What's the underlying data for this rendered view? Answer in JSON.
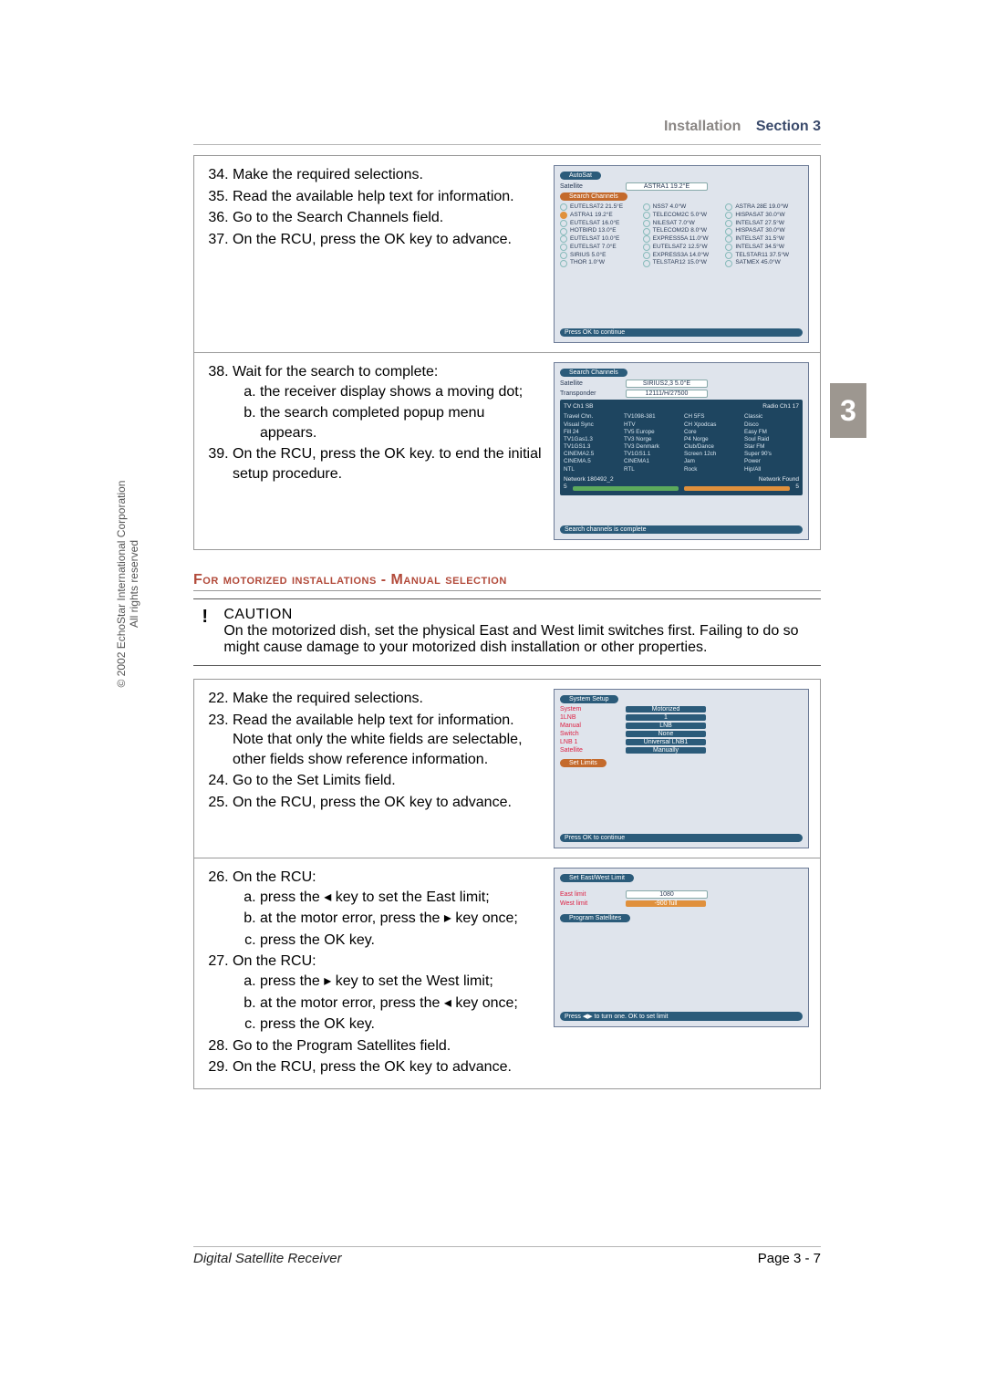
{
  "header": {
    "left": "Installation",
    "right": "Section 3"
  },
  "side_copyright": {
    "line1": "© 2002 EchoStar International Corporation",
    "line2": "All rights reserved"
  },
  "chapter_tab": "3",
  "box1": {
    "s34": "Make the required selections.",
    "s35": "Read the available help text for information.",
    "s36": "Go to the Search Channels field.",
    "s37": "On the RCU, press the OK key to advance."
  },
  "fig1": {
    "autosat": "AutoSat",
    "satellite_label": "Satellite",
    "satellite_value": "ASTRA1 19.2°E",
    "search_btn": "Search Channels",
    "footer": "Press OK to continue",
    "sats_col1": [
      "EUTELSAT2 21.5°E",
      "ASTRA1 19.2°E",
      "EUTELSAT 16.0°E",
      "HOTBIRD 13.0°E",
      "EUTELSAT 10.0°E",
      "EUTELSAT 7.0°E",
      "SIRIUS 5.0°E",
      "THOR 1.0°W"
    ],
    "sats_col2": [
      "NSS7 4.0°W",
      "TELECOM2C 5.0°W",
      "NILESAT 7.0°W",
      "TELECOM2D 8.0°W",
      "EXPRESS5A 11.0°W",
      "EUTELSAT2 12.5°W",
      "EXPRESS3A 14.0°W",
      "TELSTAR12 15.0°W"
    ],
    "sats_col3": [
      "ASTRA 28E 19.0°W",
      "HISPASAT 30.0°W",
      "INTELSAT 27.5°W",
      "HISPASAT 30.0°W",
      "INTELSAT 31.5°W",
      "INTELSAT 34.5°W",
      "TELSTAR11 37.5°W",
      "SATMEX 45.0°W"
    ]
  },
  "box2": {
    "s38": "Wait for the search to complete:",
    "s38a": "the receiver display shows a moving dot;",
    "s38b": "the search completed popup menu appears.",
    "s39": "On the RCU, press the OK key. to end the initial setup procedure."
  },
  "fig2": {
    "btn": "Search Channels",
    "satellite_label": "Satellite",
    "satellite_value": "SIRIUS2,3 5.0°E",
    "transponder_label": "Transponder",
    "transponder_value": "12111/H/27500",
    "tv_header": "TV Ch1 SB",
    "radio_header": "Radio Ch1 17",
    "tv_col1": [
      "Travel Chn.",
      "Visual Sync",
      "Fill 24",
      "TV1Gas1.3",
      "TV1GS1.3",
      "CINEMA2.5",
      "CINEMA.5",
      "NTL"
    ],
    "tv_col2": [
      "TV1098-381",
      "HTV",
      "TV5 Europe",
      "TV3 Norge",
      "TV3 Denmark",
      "TV1GS1.1",
      "CINEMA1",
      "RTL"
    ],
    "radio_col1": [
      "CH 5FS",
      "CH Xpodcas",
      "Core",
      "P4 Norge",
      "Club/Dance",
      "Screen 12ch",
      "Jam",
      "Rock"
    ],
    "radio_col2": [
      "Classic",
      "Disco",
      "Easy FM",
      "Soul Raid",
      "Star FM",
      "Super 90's",
      "Power",
      "Hip/All"
    ],
    "stats_left": "Network 180492_2",
    "stats_right": "Network Found",
    "tp_left": "5",
    "tp_right": "5",
    "footer": "Search channels is complete"
  },
  "subheading": "For motorized installations - Manual selection",
  "caution": {
    "title": "CAUTION",
    "body": "On the motorized dish, set the physical East and West limit switches first. Failing to do so might cause damage to your motorized dish installation or other properties."
  },
  "box3": {
    "s22": "Make the required selections.",
    "s23": "Read the available help text for information. Note that only the white fields are selectable, other fields show reference information.",
    "s24": "Go to the Set Limits field.",
    "s25": "On the RCU, press the OK key to advance."
  },
  "fig3": {
    "btn": "System Setup",
    "rows": [
      {
        "label": "System",
        "value": "Motorized"
      },
      {
        "label": "1LNB",
        "value": "1"
      },
      {
        "label": "Manual",
        "value": "LNB"
      },
      {
        "label": "Switch",
        "value": "None"
      },
      {
        "label": "LNB 1",
        "value": "Universal LNB1"
      },
      {
        "label": "Satellite",
        "value": "Manually"
      }
    ],
    "set_limits": "Set Limits",
    "footer": "Press OK to continue"
  },
  "box4": {
    "s26": "On the RCU:",
    "s26a": "press the ◂ key to set the East limit;",
    "s26b": "at the motor error, press the ▸ key once;",
    "s26c": "press the OK key.",
    "s27": "On the RCU:",
    "s27a": "press the ▸ key to set the West limit;",
    "s27b": "at the motor error, press the ◂ key once;",
    "s27c": "press the OK key.",
    "s28": "Go to the Program Satellites field.",
    "s29": "On the RCU, press the OK key to advance."
  },
  "fig4": {
    "btn": "Set East/West Limit",
    "east_label": "East limit",
    "east_value": "1080",
    "west_label": "West limit",
    "west_value": "-900 full",
    "program": "Program Satellites",
    "footer": "Press ◀▶ to turn one. OK to set limit"
  },
  "footer": {
    "left": "Digital Satellite Receiver",
    "right": "Page 3 - 7"
  }
}
